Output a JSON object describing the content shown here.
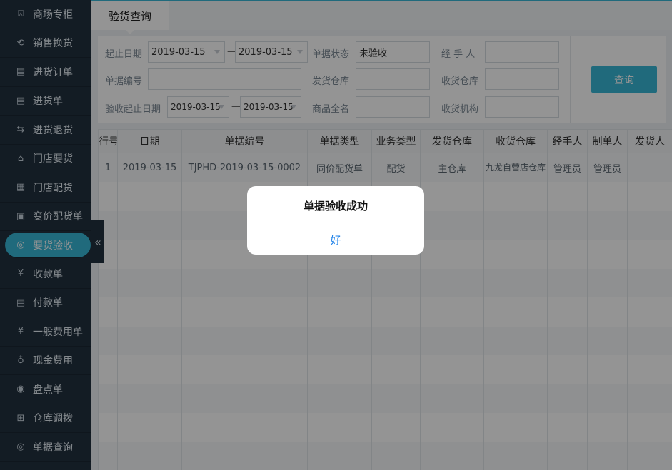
{
  "sidebar": {
    "items": [
      {
        "label": "商场专柜",
        "icon": "shopping-bag-icon",
        "glyph": "⍓"
      },
      {
        "label": "销售换货",
        "icon": "exchange-icon",
        "glyph": "⟲"
      },
      {
        "label": "进货订单",
        "icon": "purchase-order-icon",
        "glyph": "▤"
      },
      {
        "label": "进货单",
        "icon": "purchase-receipt-icon",
        "glyph": "▤"
      },
      {
        "label": "进货退货",
        "icon": "purchase-return-icon",
        "glyph": "⇆"
      },
      {
        "label": "门店要货",
        "icon": "store-request-icon",
        "glyph": "⌂"
      },
      {
        "label": "门店配货",
        "icon": "store-distribution-icon",
        "glyph": "▦"
      },
      {
        "label": "变价配货单",
        "icon": "price-change-icon",
        "glyph": "▣"
      },
      {
        "label": "要货验收",
        "icon": "inspection-icon",
        "glyph": "◎"
      },
      {
        "label": "收款单",
        "icon": "receipt-icon",
        "glyph": "¥"
      },
      {
        "label": "付款单",
        "icon": "payment-icon",
        "glyph": "▤"
      },
      {
        "label": "一般费用单",
        "icon": "yen-circle-icon",
        "glyph": "¥"
      },
      {
        "label": "现金费用",
        "icon": "money-bag-icon",
        "glyph": "♁"
      },
      {
        "label": "盘点单",
        "icon": "stocktake-icon",
        "glyph": "◉"
      },
      {
        "label": "仓库调拨",
        "icon": "cart-icon",
        "glyph": "⊞"
      },
      {
        "label": "单据查询",
        "icon": "document-search-icon",
        "glyph": "◎"
      }
    ],
    "active_index": 8
  },
  "tab": {
    "title": "验货查询"
  },
  "filter": {
    "date_label": "起止日期",
    "date_from": "2019-03-15",
    "date_to": "2019-03-15",
    "dash": "—",
    "status_label": "单据状态",
    "status_value": "未验收",
    "handler_label": "经 手 人",
    "handler_value": "",
    "doc_no_label": "单据编号",
    "doc_no_value": "",
    "ship_wh_label": "发货仓库",
    "ship_wh_value": "",
    "recv_wh_label": "收货仓库",
    "recv_wh_value": "",
    "inspect_date_label": "验收起止日期",
    "inspect_from": "2019-03-15",
    "inspect_to": "2019-03-15",
    "product_label": "商品全名",
    "product_value": "",
    "recv_org_label": "收货机构",
    "recv_org_value": "",
    "query_button": "查询"
  },
  "table": {
    "headers": [
      "行号",
      "日期",
      "单据编号",
      "单据类型",
      "业务类型",
      "发货仓库",
      "收货仓库",
      "经手人",
      "制单人",
      "发货人"
    ],
    "rows": [
      [
        "1",
        "2019-03-15",
        "TJPHD-2019-03-15-0002",
        "同价配货单",
        "配货",
        "主仓库",
        "九龙自营店仓库",
        "管理员",
        "管理员",
        ""
      ]
    ]
  },
  "dialog": {
    "message": "单据验收成功",
    "ok_button": "好"
  },
  "colors": {
    "accent": "#37b7d6",
    "sidebar_bg": "#22313f",
    "dialog_button": "#1a7fe8"
  }
}
